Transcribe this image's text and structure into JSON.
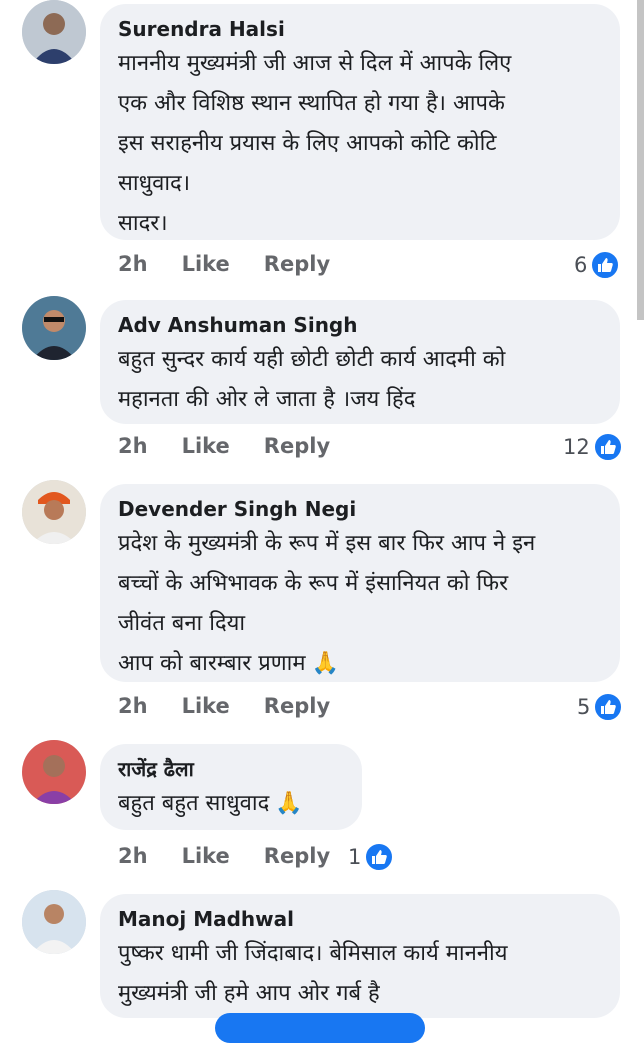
{
  "comments": [
    {
      "author": "Surendra Halsi",
      "text": "माननीय मुख्यमंत्री जी आज से दिल में आपके लिए\nएक और विशिष्ठ स्थान स्थापित हो गया है। आपके\nइस सराहनीय प्रयास के लिए आपको कोटि कोटि\nसाधुवाद।\nसादर।",
      "time": "2h",
      "like": "Like",
      "reply": "Reply",
      "reactions": "6",
      "avatar_icon": "person-avatar-icon"
    },
    {
      "author": "Adv Anshuman Singh",
      "text": "बहुत सुन्दर कार्य यही छोटी छोटी कार्य आदमी को\nमहानता की ओर ले जाता है ।जय हिंद",
      "time": "2h",
      "like": "Like",
      "reply": "Reply",
      "reactions": "12",
      "avatar_icon": "person-avatar-icon"
    },
    {
      "author": "Devender Singh Negi",
      "text": "प्रदेश के मुख्यमंत्री के रूप में इस बार फिर आप ने इन\nबच्चों के अभिभावक के रूप में इंसानियत को फिर\nजीवंत बना दिया\nआप को बारम्बार प्रणाम",
      "time": "2h",
      "like": "Like",
      "reply": "Reply",
      "reactions": "5",
      "avatar_icon": "person-avatar-icon"
    },
    {
      "author": "राजेंद्र ढैला",
      "text": "बहुत बहुत साधुवाद",
      "time": "2h",
      "like": "Like",
      "reply": "Reply",
      "reactions": "1",
      "avatar_icon": "person-avatar-icon"
    },
    {
      "author": "Manoj Madhwal",
      "text": "पुष्कर धामी जी जिंदाबाद। बेमिसाल कार्य माननीय\nमुख्यमंत्री जी हमे आप ओर गर्ब है",
      "avatar_icon": "person-avatar-icon"
    }
  ],
  "emoji": {
    "pray": "🙏"
  },
  "colors": {
    "like_blue": "#1877f2",
    "bubble": "#eff1f5",
    "meta_gray": "#65676b"
  }
}
